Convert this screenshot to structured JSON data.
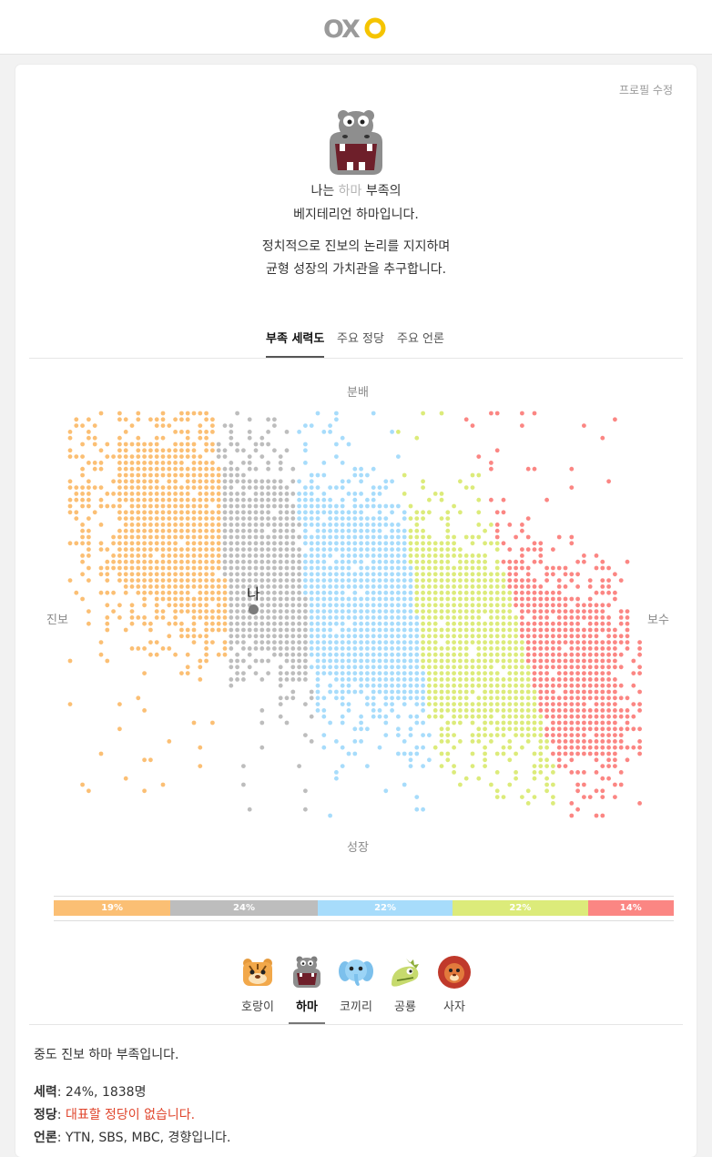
{
  "brand": {
    "name": "OXO",
    "colors": {
      "gray": "#9a9a9a",
      "yellow": "#f5c400"
    }
  },
  "profile": {
    "edit_label": "프로필 수정",
    "line1_pre": "나는 ",
    "line1_tribe": "하마",
    "line1_post": " 부족의",
    "line2": "베지테리언 하마입니다.",
    "line3": "정치적으로 진보의 논리를 지지하며",
    "line4": "균형 성장의 가치관을 추구합니다."
  },
  "tabs": [
    {
      "label": "부족 세력도",
      "active": true
    },
    {
      "label": "주요 정당",
      "active": false
    },
    {
      "label": "주요 언론",
      "active": false
    }
  ],
  "map": {
    "axis_top": "분배",
    "axis_bottom": "성장",
    "axis_left": "진보",
    "axis_right": "보수",
    "me_label": "나"
  },
  "distribution": [
    {
      "tribe": "호랑이",
      "percent": 19,
      "label": "19%",
      "color": "#fbbf74"
    },
    {
      "tribe": "하마",
      "percent": 24,
      "label": "24%",
      "color": "#bdbdbd"
    },
    {
      "tribe": "코끼리",
      "percent": 22,
      "label": "22%",
      "color": "#a7dcfb"
    },
    {
      "tribe": "공룡",
      "percent": 22,
      "label": "22%",
      "color": "#dceb7a"
    },
    {
      "tribe": "사자",
      "percent": 14,
      "label": "14%",
      "color": "#fb8683"
    }
  ],
  "tribes": [
    {
      "name": "호랑이",
      "icon": "tiger-icon",
      "active": false
    },
    {
      "name": "하마",
      "icon": "hippo-icon",
      "active": true
    },
    {
      "name": "코끼리",
      "icon": "elephant-icon",
      "active": false
    },
    {
      "name": "공룡",
      "icon": "dinosaur-icon",
      "active": false
    },
    {
      "name": "사자",
      "icon": "lion-icon",
      "active": false
    }
  ],
  "tribe_detail": {
    "summary": "중도 진보 하마 부족입니다.",
    "power_label": "세력",
    "power_value": ": 24%, 1838명",
    "party_label": "정당",
    "party_sep": ": ",
    "party_value": "대표할 정당이 없습니다.",
    "media_label": "언론",
    "media_value": ": YTN, SBS, MBC, 경향입니다."
  }
}
